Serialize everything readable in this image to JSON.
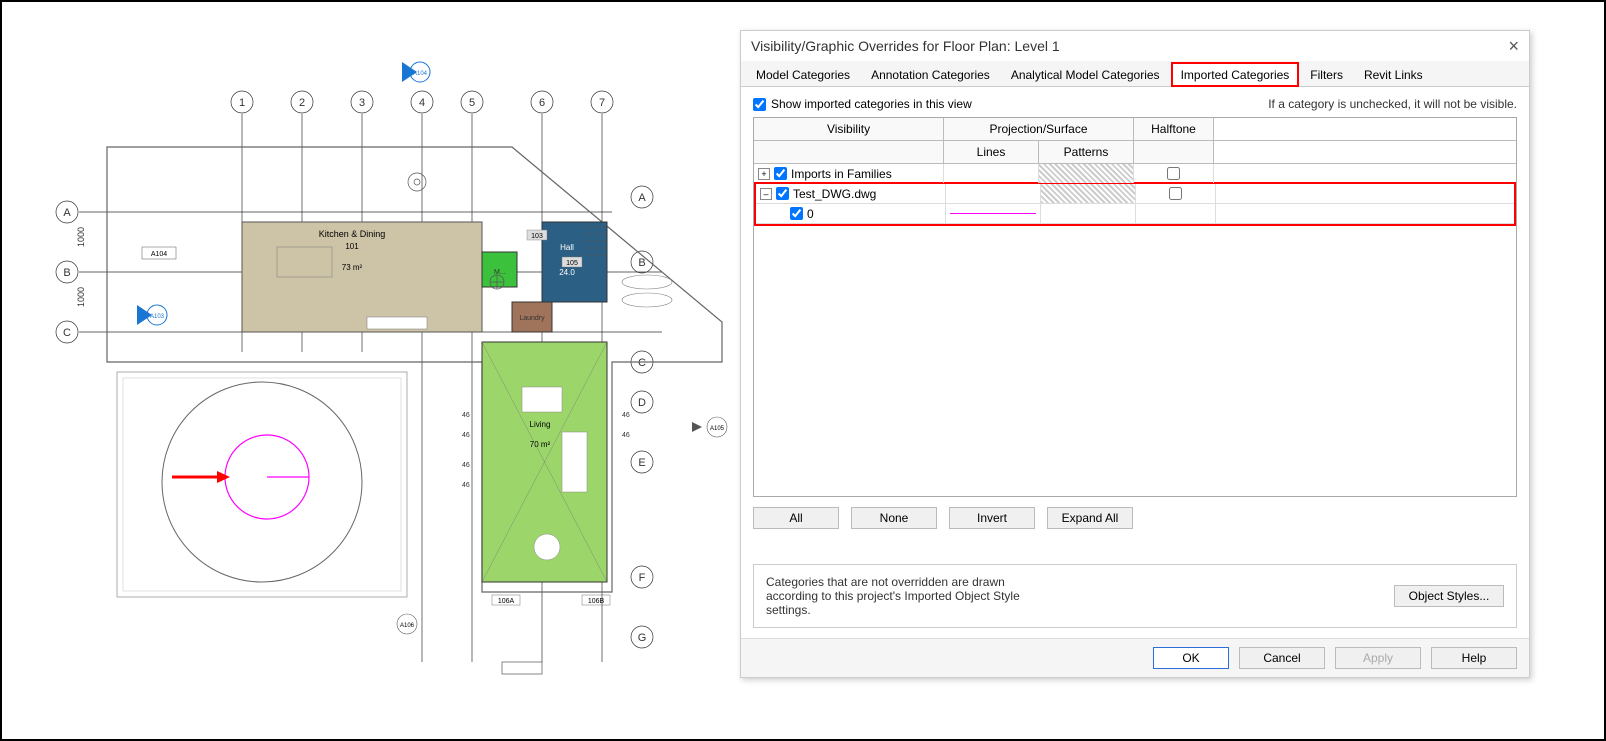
{
  "dialog": {
    "title": "Visibility/Graphic Overrides for Floor Plan: Level 1",
    "tabs": [
      "Model Categories",
      "Annotation Categories",
      "Analytical Model Categories",
      "Imported Categories",
      "Filters",
      "Revit Links"
    ],
    "active_tab": 3,
    "highlight_tab": 3,
    "show_check_label": "Show imported categories in this view",
    "show_check_checked": true,
    "hint": "If a category is unchecked, it will not be visible.",
    "columns": {
      "visibility": "Visibility",
      "projection_group": "Projection/Surface",
      "lines": "Lines",
      "patterns": "Patterns",
      "halftone": "Halftone"
    },
    "rows": [
      {
        "expand": "+",
        "checked": true,
        "name": "Imports in Families",
        "lines": "",
        "patterns": "pattern",
        "halftone": false,
        "indent": 0
      },
      {
        "expand": "–",
        "checked": true,
        "name": "Test_DWG.dwg",
        "lines": "",
        "patterns": "pattern",
        "halftone": false,
        "indent": 0
      },
      {
        "expand": "",
        "checked": true,
        "name": "0",
        "lines": "magenta",
        "patterns": "",
        "halftone": null,
        "indent": 1
      }
    ],
    "highlight_rows": [
      1,
      2
    ],
    "buttons": {
      "all": "All",
      "none": "None",
      "invert": "Invert",
      "expand_all": "Expand All"
    },
    "info": "Categories that are not overridden are drawn according to this project's Imported Object Style settings.",
    "object_styles": "Object Styles...",
    "footer": {
      "ok": "OK",
      "cancel": "Cancel",
      "apply": "Apply",
      "help": "Help"
    }
  },
  "floorplan": {
    "grid_cols": [
      "1",
      "2",
      "3",
      "4",
      "5",
      "6",
      "7"
    ],
    "grid_rows_left": [
      "A",
      "B",
      "C"
    ],
    "grid_rows_right": [
      "A",
      "B",
      "C",
      "D",
      "E",
      "F",
      "G"
    ],
    "rooms": [
      "Kitchen & Dining",
      "Hall",
      "Laundry",
      "Living",
      "M..."
    ],
    "room_numbers": [
      "101",
      "103",
      "105",
      "106A",
      "106B"
    ],
    "areas": [
      "73 m²",
      "70 m²",
      "24.0"
    ],
    "dims": [
      "1000",
      "1000"
    ],
    "section_marks": [
      "A103",
      "A104",
      "A104",
      "A105",
      "A106"
    ],
    "level_marks": [
      "46",
      "46",
      "46",
      "46",
      "46",
      "46"
    ],
    "arrow": "→",
    "dwg_shape": "circle"
  }
}
